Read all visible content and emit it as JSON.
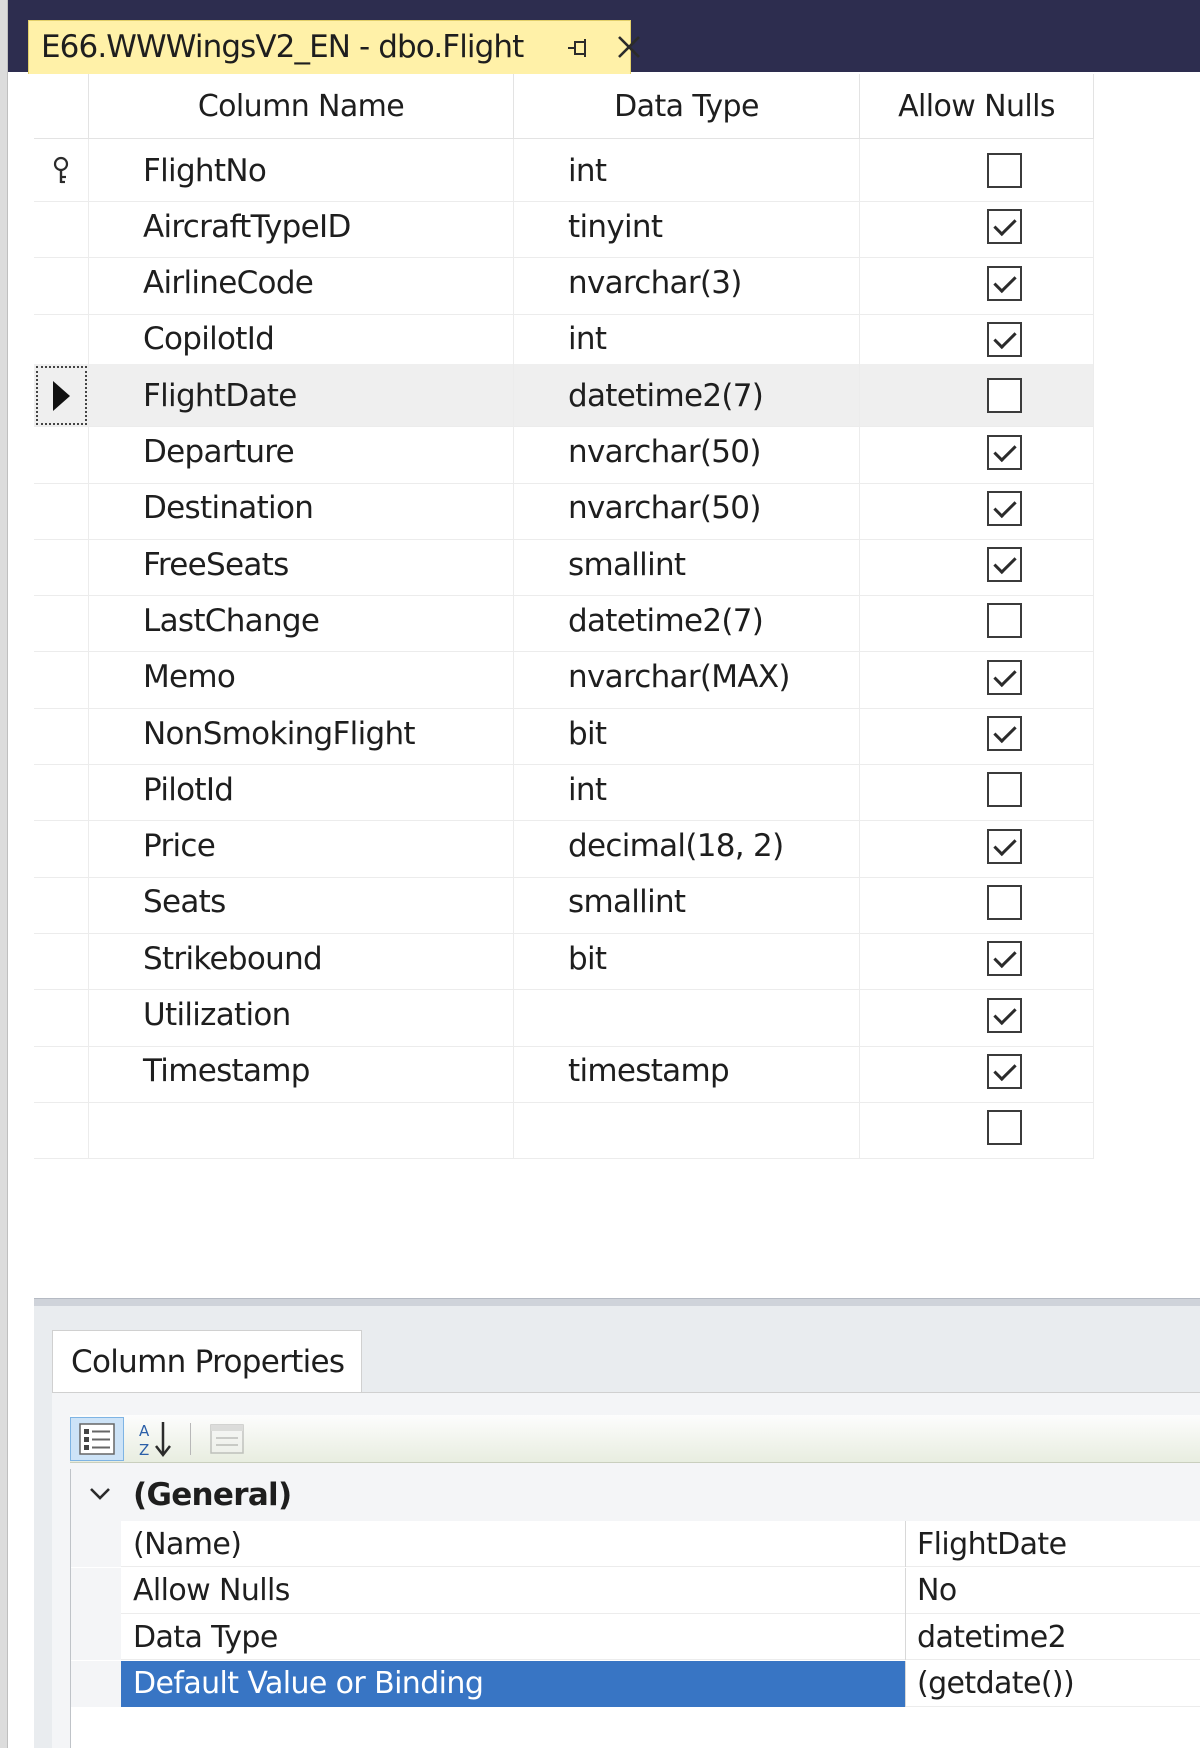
{
  "tab": {
    "title": "E66.WWWingsV2_EN - dbo.Flight",
    "pin_icon": "pin-icon",
    "close_icon": "close-icon"
  },
  "grid": {
    "headers": {
      "column_name": "Column Name",
      "data_type": "Data Type",
      "allow_nulls": "Allow Nulls"
    },
    "rows": [
      {
        "name": "FlightNo",
        "type": "int",
        "allow_nulls": false,
        "marker": "primary-key-icon"
      },
      {
        "name": "AircraftTypeID",
        "type": "tinyint",
        "allow_nulls": true
      },
      {
        "name": "AirlineCode",
        "type": "nvarchar(3)",
        "allow_nulls": true
      },
      {
        "name": "CopilotId",
        "type": "int",
        "allow_nulls": true
      },
      {
        "name": "FlightDate",
        "type": "datetime2(7)",
        "allow_nulls": false,
        "marker": "row-pointer-icon",
        "selected": true
      },
      {
        "name": "Departure",
        "type": "nvarchar(50)",
        "allow_nulls": true
      },
      {
        "name": "Destination",
        "type": "nvarchar(50)",
        "allow_nulls": true
      },
      {
        "name": "FreeSeats",
        "type": "smallint",
        "allow_nulls": true
      },
      {
        "name": "LastChange",
        "type": "datetime2(7)",
        "allow_nulls": false
      },
      {
        "name": "Memo",
        "type": "nvarchar(MAX)",
        "allow_nulls": true
      },
      {
        "name": "NonSmokingFlight",
        "type": "bit",
        "allow_nulls": true
      },
      {
        "name": "PilotId",
        "type": "int",
        "allow_nulls": false
      },
      {
        "name": "Price",
        "type": "decimal(18, 2)",
        "allow_nulls": true
      },
      {
        "name": "Seats",
        "type": "smallint",
        "allow_nulls": false
      },
      {
        "name": "Strikebound",
        "type": "bit",
        "allow_nulls": true
      },
      {
        "name": "Utilization",
        "type": "",
        "allow_nulls": true
      },
      {
        "name": "Timestamp",
        "type": "timestamp",
        "allow_nulls": true
      },
      {
        "name": "",
        "type": "",
        "allow_nulls": false
      }
    ]
  },
  "properties": {
    "tab_label": "Column Properties",
    "toolbar": {
      "categorized_icon": "categorized-icon",
      "alphabetical_icon": "sort-alphabetical-icon",
      "property_pages_icon": "property-pages-icon"
    },
    "category": "(General)",
    "rows": [
      {
        "name": "(Name)",
        "value": "FlightDate"
      },
      {
        "name": "Allow Nulls",
        "value": "No"
      },
      {
        "name": "Data Type",
        "value": "datetime2"
      },
      {
        "name": "Default Value or Binding",
        "value": "(getdate())",
        "highlight": true
      }
    ]
  },
  "colors": {
    "tab_background": "#fff1a8",
    "title_bar": "#2d2d4f",
    "selection_highlight": "#3875c4",
    "selected_row": "#efefef"
  }
}
